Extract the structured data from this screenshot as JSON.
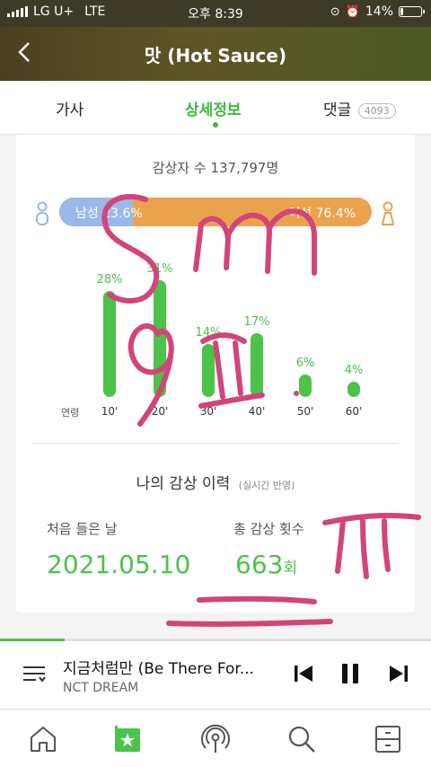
{
  "status_bar": {
    "carrier": "LG U+",
    "network": "LTE",
    "time": "오후 8:39",
    "battery": "14%",
    "battery_level": 0.14
  },
  "header": {
    "title": "맛 (Hot Sauce)",
    "back_icon": "chevron-left-icon"
  },
  "tabs": {
    "lyrics": "가사",
    "details": "상세정보",
    "comments": "댓글",
    "comment_count": "4093"
  },
  "stats": {
    "listeners": "감상자 수 137,797명",
    "gender": {
      "male_label": "남성 23.6%",
      "female_label": "여성 76.4%",
      "male_share": 0.236
    },
    "age_axis_label": "연령",
    "age": [
      {
        "label": "10'",
        "pct_label": "28%",
        "pct": 28
      },
      {
        "label": "20'",
        "pct_label": "31%",
        "pct": 31
      },
      {
        "label": "30'",
        "pct_label": "14%",
        "pct": 14
      },
      {
        "label": "40'",
        "pct_label": "17%",
        "pct": 17
      },
      {
        "label": "50'",
        "pct_label": "6%",
        "pct": 6
      },
      {
        "label": "60'",
        "pct_label": "4%",
        "pct": 4
      }
    ]
  },
  "history": {
    "title": "나의 감상 이력",
    "realtime_note": "(실시간 반영)",
    "first_listen_label": "처음 들은 날",
    "first_listen_value": "2021.05.10",
    "total_plays_label": "총 감상 횟수",
    "total_plays_value": "663",
    "total_plays_unit": "회"
  },
  "player": {
    "song": "지금처럼만 (Be There For...",
    "artist": "NCT DREAM",
    "progress": 0.15
  },
  "bottom_nav": [
    "home-icon",
    "my-music-icon",
    "podcast-icon",
    "search-icon",
    "menu-icon"
  ],
  "colors": {
    "accent": "#4cc34a",
    "male": "#9ab8ea",
    "female": "#eba24d",
    "scribble": "#d2447a"
  }
}
